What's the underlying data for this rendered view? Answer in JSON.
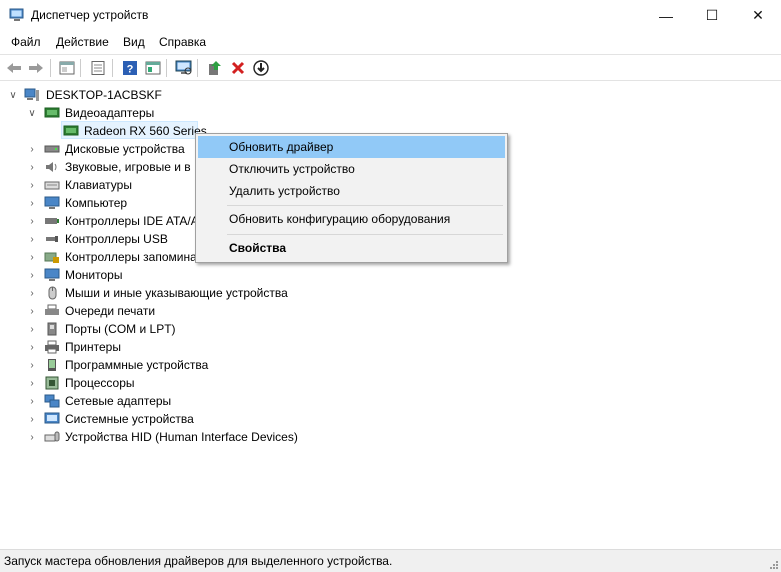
{
  "window": {
    "title": "Диспетчер устройств",
    "minimize_glyph": "—",
    "maximize_glyph": "☐",
    "close_glyph": "✕"
  },
  "menu": [
    "Файл",
    "Действие",
    "Вид",
    "Справка"
  ],
  "toolbar_icons": [
    "back-icon",
    "forward-icon",
    "properties-sheet-icon",
    "list-view-icon",
    "help-icon",
    "details-view-icon",
    "scan-hardware-icon",
    "update-driver-icon",
    "uninstall-icon",
    "install-icon"
  ],
  "tree": {
    "root": "DESKTOP-1ACBSKF",
    "expanded_category": "Видеоадаптеры",
    "selected_device": "Radeon RX 560 Series",
    "categories": [
      "Дисковые устройства",
      "Звуковые, игровые и в",
      "Клавиатуры",
      "Компьютер",
      "Контроллеры IDE ATA/A",
      "Контроллеры USB",
      "Контроллеры запомина",
      "Мониторы",
      "Мыши и иные указывающие устройства",
      "Очереди печати",
      "Порты (COM и LPT)",
      "Принтеры",
      "Программные устройства",
      "Процессоры",
      "Сетевые адаптеры",
      "Системные устройства",
      "Устройства HID (Human Interface Devices)"
    ]
  },
  "context_menu": {
    "update_driver": "Обновить драйвер",
    "disable_device": "Отключить устройство",
    "uninstall_device": "Удалить устройство",
    "scan_hardware": "Обновить конфигурацию оборудования",
    "properties": "Свойства"
  },
  "status": {
    "text": "Запуск мастера обновления драйверов для выделенного устройства."
  },
  "colors": {
    "highlight": "#91c9f7",
    "selection": "#e5f3ff",
    "uninstall_red": "#d32020",
    "help_blue": "#2b5fb4"
  }
}
